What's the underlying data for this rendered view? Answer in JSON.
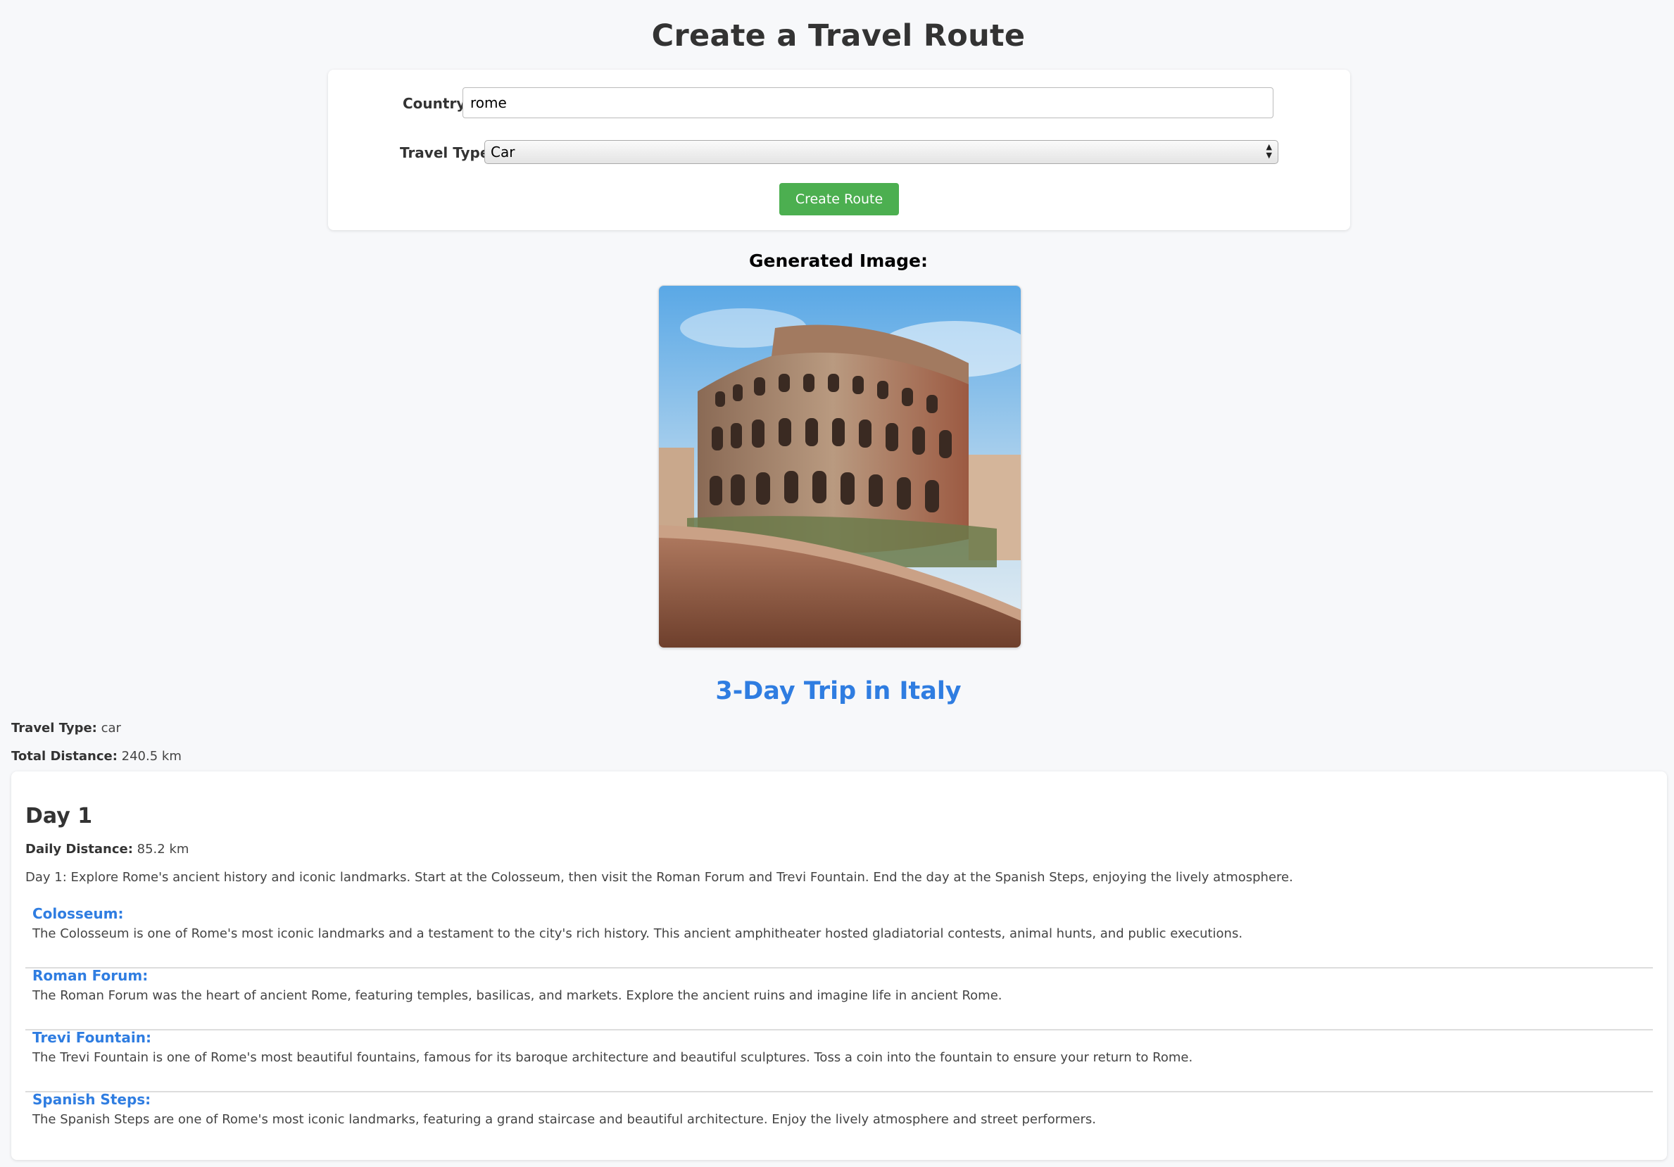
{
  "page": {
    "title": "Create a Travel Route"
  },
  "form": {
    "country_label": "Country:",
    "country_value": "rome",
    "travel_type_label": "Travel Type:",
    "travel_type_value": "Car",
    "create_button_label": "Create Route"
  },
  "image_section": {
    "heading": "Generated Image:"
  },
  "trip": {
    "title": "3-Day Trip in Italy",
    "travel_type_label": "Travel Type:",
    "travel_type_value": "car",
    "total_distance_label": "Total Distance:",
    "total_distance_value": "240.5 km"
  },
  "days": [
    {
      "title": "Day 1",
      "daily_distance_label": "Daily Distance:",
      "daily_distance_value": "85.2 km",
      "description": "Day 1: Explore Rome's ancient history and iconic landmarks. Start at the Colosseum, then visit the Roman Forum and Trevi Fountain. End the day at the Spanish Steps, enjoying the lively atmosphere.",
      "places": [
        {
          "name": "Colosseum:",
          "description": "The Colosseum is one of Rome's most iconic landmarks and a testament to the city's rich history. This ancient amphitheater hosted gladiatorial contests, animal hunts, and public executions."
        },
        {
          "name": "Roman Forum:",
          "description": "The Roman Forum was the heart of ancient Rome, featuring temples, basilicas, and markets. Explore the ancient ruins and imagine life in ancient Rome."
        },
        {
          "name": "Trevi Fountain:",
          "description": "The Trevi Fountain is one of Rome's most beautiful fountains, famous for its baroque architecture and beautiful sculptures. Toss a coin into the fountain to ensure your return to Rome."
        },
        {
          "name": "Spanish Steps:",
          "description": "The Spanish Steps are one of Rome's most iconic landmarks, featuring a grand staircase and beautiful architecture. Enjoy the lively atmosphere and street performers."
        }
      ]
    }
  ],
  "colors": {
    "accent_blue": "#2f7de1",
    "button_green": "#4caf50",
    "background": "#f7f8fa"
  }
}
